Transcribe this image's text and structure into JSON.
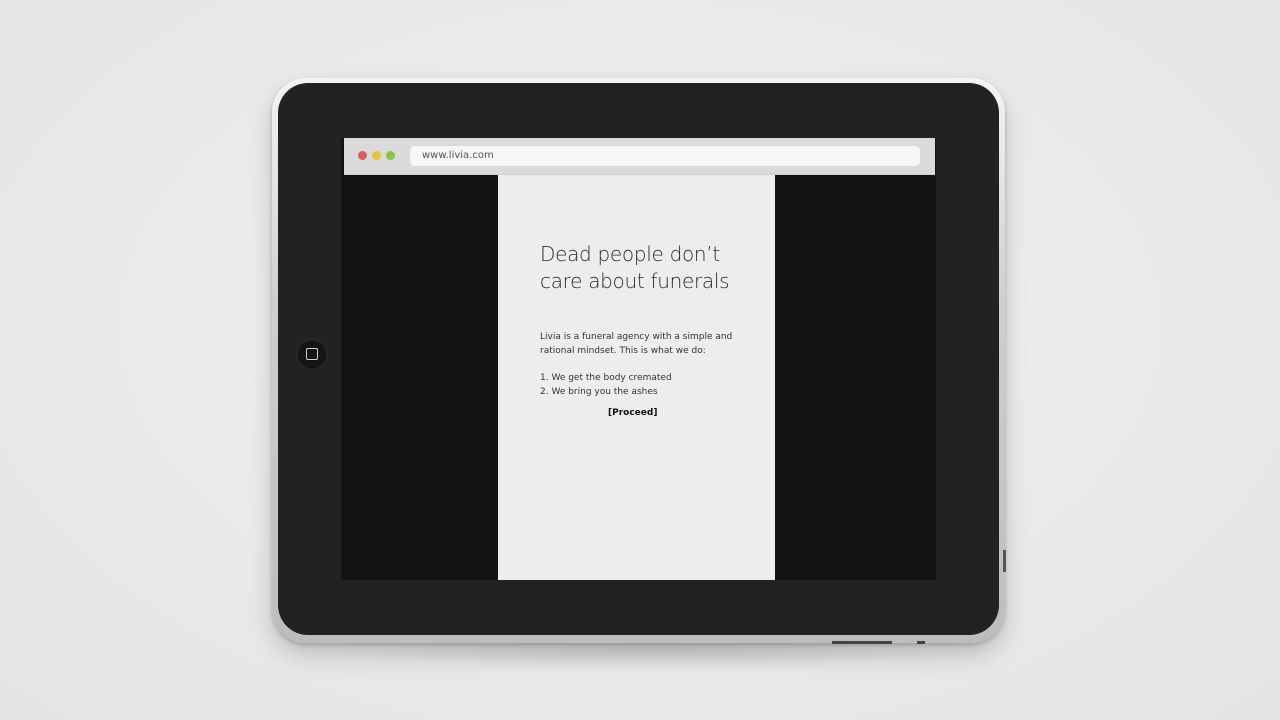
{
  "browser": {
    "url": "www.livia.com",
    "traffic_lights": {
      "close_color": "#d55d5d",
      "minimize_color": "#e6c43c",
      "maximize_color": "#8cc152"
    }
  },
  "page": {
    "headline": "Dead people don’t care about funerals",
    "intro": "Livia is a funeral agency with a simple and rational mindset. This is what we do:",
    "steps": [
      "1. We get the body cremated",
      "2. We bring you the ashes"
    ],
    "cta_label": "[Proceed]"
  },
  "colors": {
    "bezel": "#222222",
    "screen_background": "#141414",
    "page_background": "#ededed"
  },
  "icons": {
    "home_button": "home-button-square-icon"
  }
}
